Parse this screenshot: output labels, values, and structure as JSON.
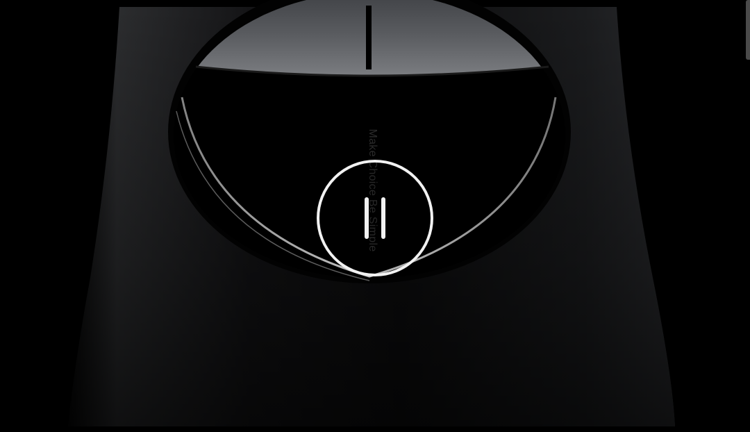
{
  "video": {
    "tagline": "Make Choice Be Simple"
  },
  "controls": {
    "pause_icon": "pause-icon",
    "state": "playing"
  },
  "colors": {
    "background": "#000000",
    "control": "#f2f2f2"
  }
}
